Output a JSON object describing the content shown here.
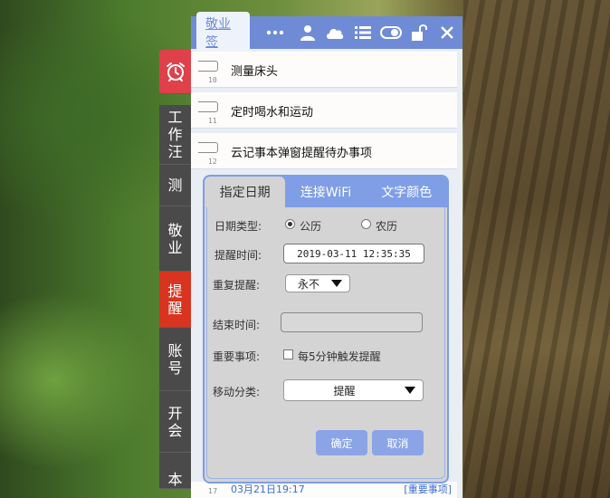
{
  "app": {
    "brand": "敬业签",
    "toolbar_icons": [
      "more-icon",
      "user-icon",
      "cloud-icon",
      "list-icon",
      "toggle-icon",
      "unlock-icon",
      "close-icon"
    ]
  },
  "left_tabs": [
    {
      "name": "alarm",
      "label": ""
    },
    {
      "name": "work",
      "label": "工作汪"
    },
    {
      "name": "test",
      "label": "测"
    },
    {
      "name": "jingye",
      "label": "敬业"
    },
    {
      "name": "reminder",
      "label": "提醒"
    },
    {
      "name": "account",
      "label": "账号"
    },
    {
      "name": "meeting",
      "label": "开会"
    },
    {
      "name": "more",
      "label": "本"
    }
  ],
  "notes": [
    {
      "num": "10",
      "text": "测量床头"
    },
    {
      "num": "11",
      "text": "定时喝水和运动"
    },
    {
      "num": "12",
      "text": "云记事本弹窗提醒待办事项"
    }
  ],
  "bottom_note": {
    "num": "17",
    "date": "03月21日19:17",
    "tag": "[重要事项]"
  },
  "dialog": {
    "tabs": [
      "指定日期",
      "连接WiFi",
      "文字颜色"
    ],
    "date_type_label": "日期类型:",
    "solar_label": "公历",
    "lunar_label": "农历",
    "remind_time_label": "提醒时间:",
    "remind_time_value": "2019-03-11  12:35:35",
    "repeat_label": "重复提醒:",
    "repeat_value": "永不",
    "end_time_label": "结束时间:",
    "important_label": "重要事项:",
    "important_checkbox_label": "每5分钟触发提醒",
    "category_label": "移动分类:",
    "category_value": "提醒",
    "confirm": "确定",
    "cancel": "取消"
  },
  "colors": {
    "accent": "#6f8bd6",
    "alarm_tab": "#e0404a",
    "active_tab": "#d9341f"
  }
}
